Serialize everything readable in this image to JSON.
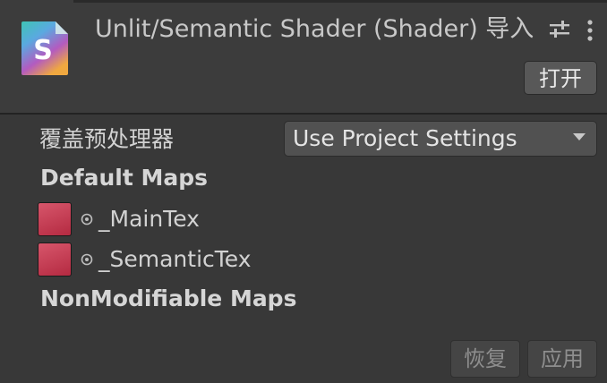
{
  "header": {
    "title": "Unlit/Semantic Shader (Shader) 导入",
    "icon_letter": "S",
    "open_label": "打开"
  },
  "settings": {
    "preprocessor_label": "覆盖预处理器",
    "preprocessor_value": "Use Project Settings"
  },
  "default_maps": {
    "heading": "Default Maps",
    "items": [
      {
        "name": "_MainTex",
        "swatch_color": "#c83a52"
      },
      {
        "name": "_SemanticTex",
        "swatch_color": "#c83a52"
      }
    ]
  },
  "nonmodifiable_maps": {
    "heading": "NonModifiable Maps"
  },
  "footer": {
    "revert_label": "恢复",
    "apply_label": "应用"
  },
  "colors": {
    "background": "#383838",
    "header_background": "#3c3c3c",
    "button": "#585858",
    "accent_swatch": "#c83a52"
  }
}
